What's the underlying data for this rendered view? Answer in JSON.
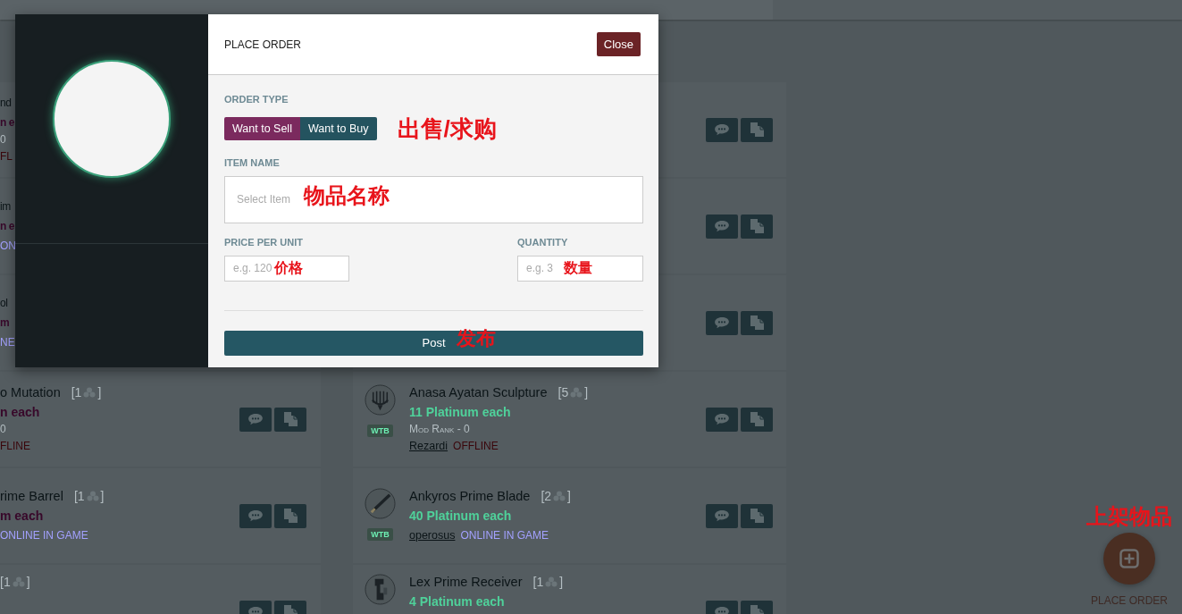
{
  "orders": {
    "columns": [
      {
        "kind": "sell",
        "cards": [
          {
            "kind": "fragment",
            "title": "nd",
            "price": "n e",
            "mod_rank": "0",
            "status": "FL",
            "online": false
          },
          {
            "kind": "fragment",
            "title": "im",
            "price": "n e",
            "status": "ON",
            "online": true
          },
          {
            "kind": "fragment",
            "title": "ol",
            "price": "m",
            "status": "NE",
            "online": true
          },
          {
            "kind": "full",
            "title": "o Mutation",
            "count_open": "[1",
            "count_close": "]",
            "price": "n each",
            "mod_rank": "0",
            "status": "FLINE",
            "online": false
          },
          {
            "kind": "full",
            "title": "rime Barrel",
            "count_open": "[1",
            "count_close": "]",
            "price": "m each",
            "status": "ONLINE IN GAME",
            "online": true
          },
          {
            "kind": "full",
            "count_open": "[1",
            "count_close": "]"
          }
        ]
      },
      {
        "kind": "buy",
        "cards": [
          {
            "kind": "covered"
          },
          {
            "kind": "covered"
          },
          {
            "kind": "covered"
          },
          {
            "kind": "full",
            "thumb": {
              "kind": "sculpture"
            },
            "badge": "WTB",
            "title": "Anasa Ayatan Sculpture",
            "count_open": "[5",
            "count_close": "]",
            "price": "11 Platinum each",
            "mod_rank": "Mod Rank - 0",
            "user": "Rezardi",
            "status": "OFFLINE",
            "online": false
          },
          {
            "kind": "full",
            "thumb": {
              "kind": "blade"
            },
            "badge": "WTB",
            "title": "Ankyros Prime Blade",
            "count_open": "[2",
            "count_close": "]",
            "price": "40 Platinum each",
            "user": "operosus",
            "status": "ONLINE IN GAME",
            "online": true
          },
          {
            "kind": "full",
            "thumb": {
              "kind": "receiver"
            },
            "title": "Lex Prime Receiver",
            "count_open": "[1",
            "count_close": "]",
            "price": "4 Platinum each"
          }
        ]
      }
    ]
  },
  "dialog": {
    "title": "PLACE ORDER",
    "close": "Close",
    "order_type": {
      "label": "ORDER TYPE",
      "options": [
        {
          "label": "Want to Sell",
          "selected": true
        },
        {
          "label": "Want to Buy",
          "selected": false
        }
      ],
      "annotation": "出售/求购"
    },
    "item_name": {
      "label": "ITEM NAME",
      "placeholder": "Select Item",
      "annotation": "物品名称"
    },
    "price": {
      "label": "PRICE PER UNIT",
      "placeholder": "e.g. 120",
      "annotation": "价格"
    },
    "quantity": {
      "label": "QUANTITY",
      "placeholder": "e.g. 3",
      "annotation": "数量"
    },
    "post": {
      "label": "Post",
      "annotation": "发布"
    }
  },
  "place_order": {
    "label": "PLACE ORDER",
    "annotation": "上架物品"
  }
}
